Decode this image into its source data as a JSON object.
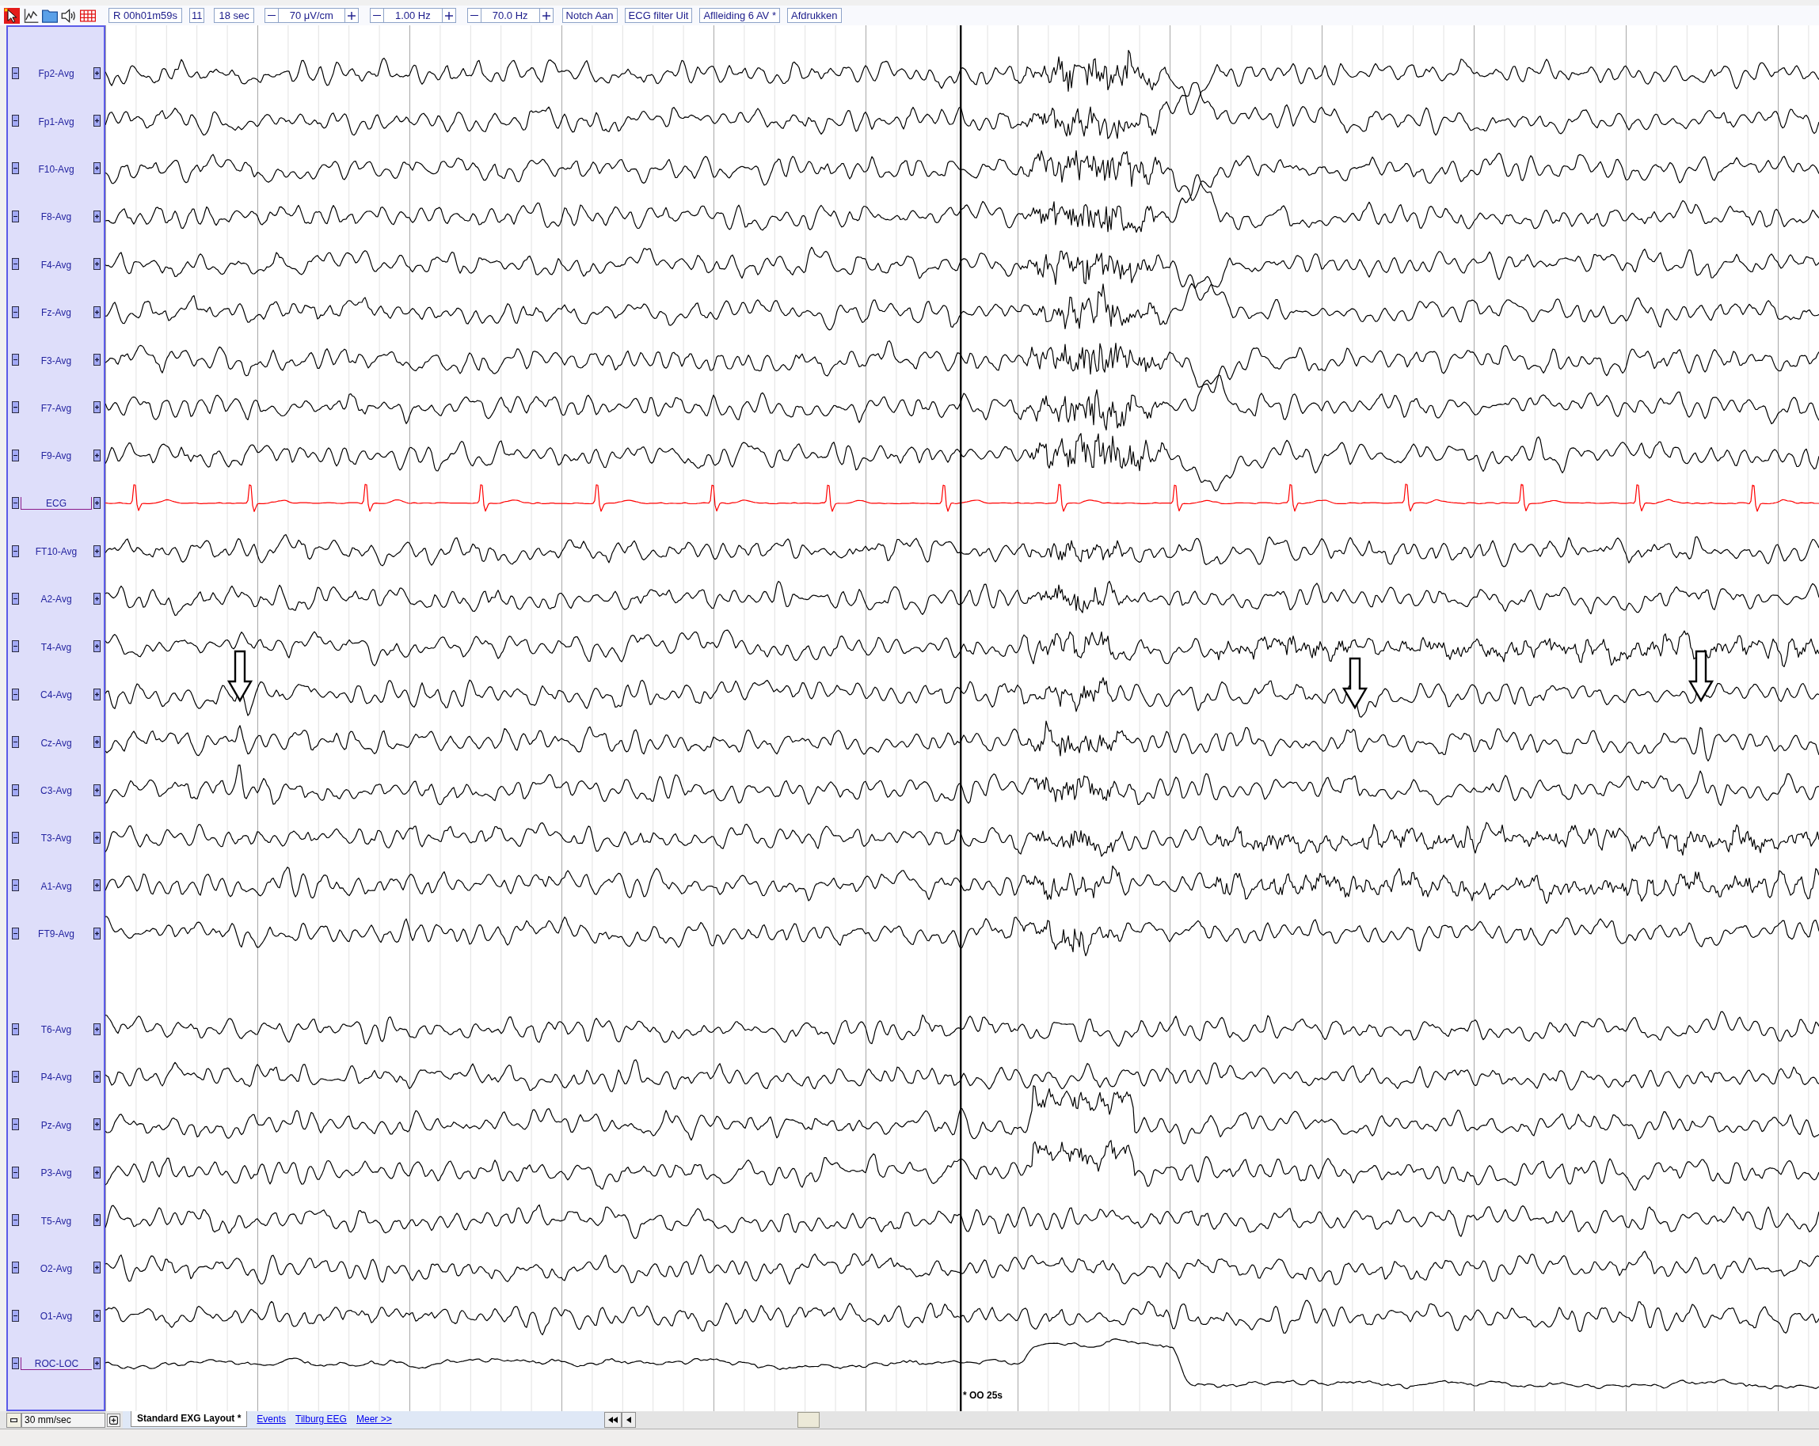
{
  "toolbar": {
    "tools": [
      {
        "kind": "pointer",
        "selected": true
      },
      {
        "kind": "chart",
        "selected": false
      },
      {
        "kind": "folder",
        "selected": false
      },
      {
        "kind": "speaker",
        "selected": false
      },
      {
        "kind": "grid",
        "selected": false
      }
    ],
    "position": "R 00h01m59s",
    "page": "11",
    "duration": "18 sec",
    "steppers": [
      {
        "value": "70 μV/cm"
      },
      {
        "value": "1.00 Hz"
      },
      {
        "value": "70.0 Hz"
      }
    ],
    "buttons": [
      "Notch Aan",
      "ECG filter Uit",
      "Aflleiding 6 AV *",
      "Afdrukken"
    ]
  },
  "montage": {
    "groups": [
      {
        "channels": [
          {
            "label": "Fp2-Avg",
            "kind": "eeg",
            "color": "#000000",
            "bracket_left": false,
            "bracket_right": false
          },
          {
            "label": "Fp1-Avg",
            "kind": "eeg",
            "color": "#000000",
            "bracket_left": false,
            "bracket_right": false
          },
          {
            "label": "F10-Avg",
            "kind": "eeg",
            "color": "#000000",
            "bracket_left": false,
            "bracket_right": false
          },
          {
            "label": "F8-Avg",
            "kind": "eeg",
            "color": "#000000",
            "bracket_left": false,
            "bracket_right": false
          },
          {
            "label": "F4-Avg",
            "kind": "eeg",
            "color": "#000000",
            "bracket_left": false,
            "bracket_right": false
          },
          {
            "label": "Fz-Avg",
            "kind": "eeg",
            "color": "#000000",
            "bracket_left": false,
            "bracket_right": false
          },
          {
            "label": "F3-Avg",
            "kind": "eeg",
            "color": "#000000",
            "bracket_left": false,
            "bracket_right": false
          },
          {
            "label": "F7-Avg",
            "kind": "eeg",
            "color": "#000000",
            "bracket_left": false,
            "bracket_right": false
          },
          {
            "label": "F9-Avg",
            "kind": "eeg",
            "color": "#000000",
            "bracket_left": false,
            "bracket_right": false
          },
          {
            "label": "ECG",
            "kind": "ecg",
            "color": "#ff0000",
            "bracket_left": true,
            "bracket_right": true
          },
          {
            "label": "FT10-Avg",
            "kind": "eeg",
            "color": "#000000",
            "bracket_left": false,
            "bracket_right": false
          },
          {
            "label": "A2-Avg",
            "kind": "eeg",
            "color": "#000000",
            "bracket_left": false,
            "bracket_right": false
          },
          {
            "label": "T4-Avg",
            "kind": "eeg",
            "color": "#000000",
            "bracket_left": false,
            "bracket_right": false
          },
          {
            "label": "C4-Avg",
            "kind": "eeg",
            "color": "#000000",
            "bracket_left": false,
            "bracket_right": false
          },
          {
            "label": "Cz-Avg",
            "kind": "eeg",
            "color": "#000000",
            "bracket_left": false,
            "bracket_right": false
          },
          {
            "label": "C3-Avg",
            "kind": "eeg",
            "color": "#000000",
            "bracket_left": false,
            "bracket_right": false
          },
          {
            "label": "T3-Avg",
            "kind": "eeg",
            "color": "#000000",
            "bracket_left": false,
            "bracket_right": false
          },
          {
            "label": "A1-Avg",
            "kind": "eeg",
            "color": "#000000",
            "bracket_left": false,
            "bracket_right": false
          },
          {
            "label": "FT9-Avg",
            "kind": "eeg",
            "color": "#000000",
            "bracket_left": false,
            "bracket_right": false
          }
        ]
      },
      {
        "channels": [
          {
            "label": "T6-Avg",
            "kind": "eeg",
            "color": "#000000",
            "bracket_left": false,
            "bracket_right": false
          },
          {
            "label": "P4-Avg",
            "kind": "eeg",
            "color": "#000000",
            "bracket_left": false,
            "bracket_right": false
          },
          {
            "label": "Pz-Avg",
            "kind": "eeg",
            "color": "#000000",
            "bracket_left": false,
            "bracket_right": false
          },
          {
            "label": "P3-Avg",
            "kind": "eeg",
            "color": "#000000",
            "bracket_left": false,
            "bracket_right": false
          },
          {
            "label": "T5-Avg",
            "kind": "eeg",
            "color": "#000000",
            "bracket_left": false,
            "bracket_right": false
          },
          {
            "label": "O2-Avg",
            "kind": "eeg",
            "color": "#000000",
            "bracket_left": false,
            "bracket_right": false
          },
          {
            "label": "O1-Avg",
            "kind": "eeg",
            "color": "#000000",
            "bracket_left": false,
            "bracket_right": false
          },
          {
            "label": "ROC-LOC",
            "kind": "eog",
            "color": "#000000",
            "bracket_left": true,
            "bracket_right": false
          }
        ]
      }
    ]
  },
  "events": [
    {
      "label": "* OO 25s"
    }
  ],
  "bottom_bar": {
    "speed": "30 mm/sec",
    "tabs": [
      {
        "label": "Standard EXG Layout *",
        "selected": true
      },
      {
        "label": "Events",
        "selected": false
      },
      {
        "label": "Tilburg EEG",
        "selected": false
      },
      {
        "label": "Meer >>",
        "selected": false
      }
    ]
  }
}
